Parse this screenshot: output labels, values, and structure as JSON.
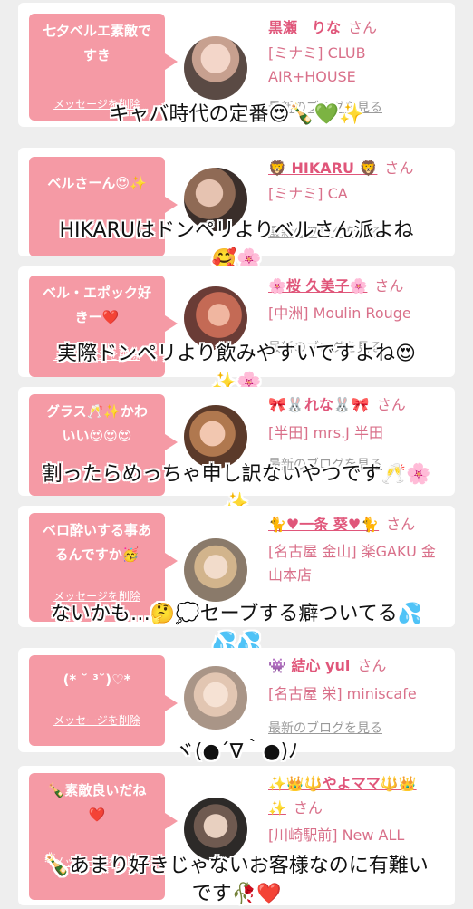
{
  "colors": {
    "background": "#eeeeee",
    "bubble": "#f59aa5",
    "name_pink": "#e0567a",
    "link_gray": "#9a9a9a"
  },
  "delete_label": "メッセージを削除",
  "honorific": "さん",
  "cards": [
    {
      "message": "七夕ベルエ素敵ですき",
      "name": "黒瀬　りな",
      "shop": "[ミナミ] CLUB AIR+HOUSE",
      "blog": "最新のブログを見る",
      "caption": "キャバ時代の定番😍🍾💚✨",
      "avatar_icon": "avatar-photo"
    },
    {
      "message": "ベルさーん😍✨",
      "name": "🦁 HIKARU 🦁",
      "shop": "[ミナミ] CA",
      "blog": "最新のブログを見る",
      "caption": "HIKARUはドンペリよりベルさん派よね",
      "caption2": "🥰🌸",
      "avatar_icon": "avatar-photo"
    },
    {
      "message": "ベル・エポック好きー❤️",
      "name": "🌸桜 久美子🌸",
      "shop": "[中洲] Moulin Rouge",
      "blog": "最新のブログを見る",
      "caption": "実際ドンペリより飲みやすいですよね😍",
      "caption2": "✨🌸",
      "avatar_icon": "avatar-photo"
    },
    {
      "message": "グラス🥂✨かわいい😍😍😍",
      "name": "🎀🐰れな🐰🎀",
      "shop": "[半田] mrs.J 半田",
      "blog": "最新のブログを見る",
      "caption": "割ったらめっちゃ申し訳ないやつです🥂🌸",
      "caption2": "✨",
      "avatar_icon": "avatar-photo"
    },
    {
      "message": "ベロ酔いする事あるんですか🥳",
      "name": "🐈♥一条 葵♥🐈",
      "shop": "[名古屋 金山] 楽GAKU 金山本店",
      "blog": "",
      "caption": "ないかも…🤔💭セーブする癖ついてる💦",
      "caption2": "💦💦",
      "avatar_icon": "avatar-photo"
    },
    {
      "message": "(* ˘ ³˘)♡*",
      "name": "👾 結心 yui",
      "shop": "[名古屋 栄] miniscafe",
      "blog": "最新のブログを見る",
      "caption": "ヾ(●´∇｀●)ﾉ",
      "avatar_icon": "avatar-photo"
    },
    {
      "message": "🍾素敵良いだね❤️",
      "name": "✨👑🔱やよママ🔱👑",
      "name2": "✨",
      "shop": "[川崎駅前] New ALL",
      "blog": "",
      "caption": "🍾あまり好きじゃないお客様なのに有難い",
      "caption2": "です🥀❤️",
      "avatar_icon": "avatar-photo"
    }
  ]
}
